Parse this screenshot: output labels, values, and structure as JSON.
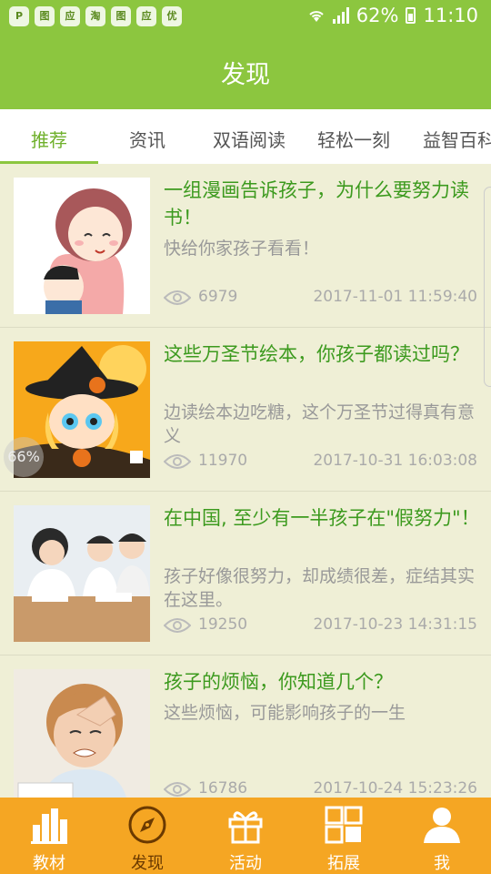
{
  "status_bar": {
    "app_icons": [
      "P",
      "图",
      "应",
      "淘",
      "图",
      "应",
      "优"
    ],
    "battery": "62%",
    "time": "11:10"
  },
  "header": {
    "title": "发现"
  },
  "tabs": [
    {
      "label": "推荐",
      "active": true
    },
    {
      "label": "资讯",
      "active": false
    },
    {
      "label": "双语阅读",
      "active": false
    },
    {
      "label": "轻松一刻",
      "active": false
    },
    {
      "label": "益智百科",
      "active": false
    }
  ],
  "articles": [
    {
      "title": "一组漫画告诉孩子，为什么要努力读书！",
      "subtitle": "快给你家孩子看看！",
      "views": "6979",
      "date": "2017-11-01 11:59:40"
    },
    {
      "title": "这些万圣节绘本，你孩子都读过吗？",
      "subtitle": "边读绘本边吃糖，这个万圣节过得真有意义",
      "views": "11970",
      "date": "2017-10-31 16:03:08"
    },
    {
      "title": "在中国, 至少有一半孩子在\"假努力\"！",
      "subtitle": "孩子好像很努力，却成绩很差，症结其实在这里。",
      "views": "19250",
      "date": "2017-10-23 14:31:15"
    },
    {
      "title": "孩子的烦恼，你知道几个？",
      "subtitle": "这些烦恼，可能影响孩子的一生",
      "views": "16786",
      "date": "2017-10-24 15:23:26"
    }
  ],
  "progress_badge": "66%",
  "bottom_nav": [
    {
      "label": "教材",
      "icon": "bar-chart-icon",
      "active": false
    },
    {
      "label": "发现",
      "icon": "compass-icon",
      "active": true
    },
    {
      "label": "活动",
      "icon": "gift-icon",
      "active": false
    },
    {
      "label": "拓展",
      "icon": "grid-icon",
      "active": false
    },
    {
      "label": "我",
      "icon": "person-icon",
      "active": false
    }
  ],
  "colors": {
    "header_green": "#8cc63f",
    "title_green": "#3c9a1e",
    "nav_orange": "#f5a623",
    "list_bg": "#efefd6"
  }
}
